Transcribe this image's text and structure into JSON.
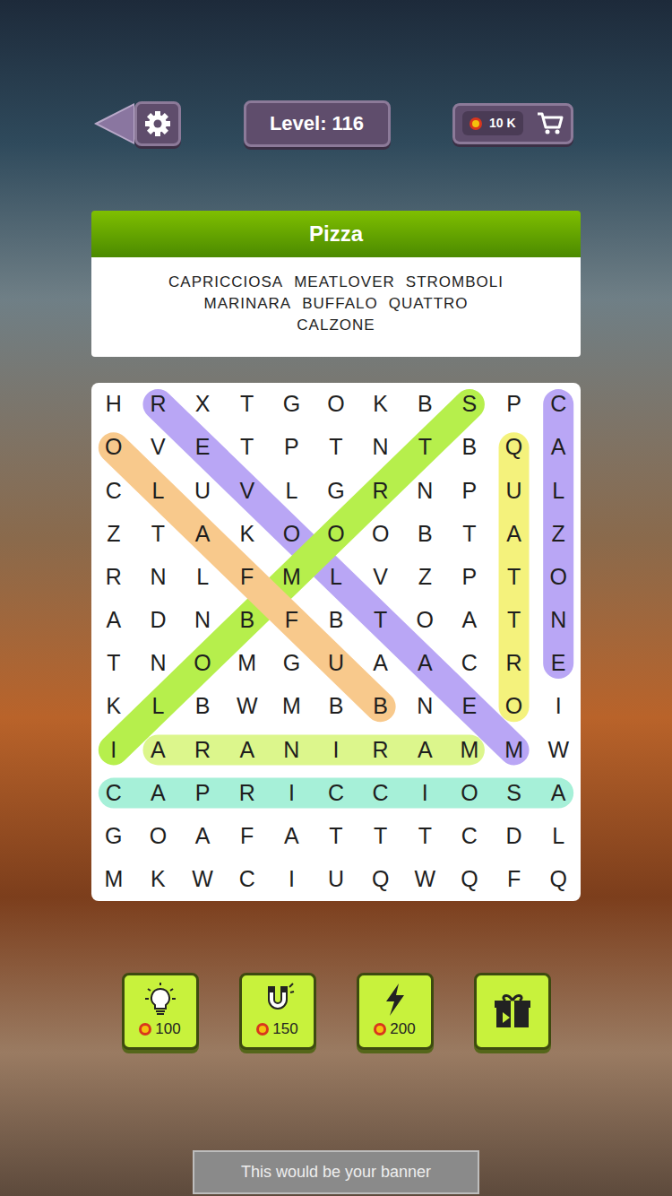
{
  "topbar": {
    "level": "Level: 116",
    "coins": "10 K"
  },
  "puzzle": {
    "title": "Pizza",
    "word_lines": [
      [
        "CAPRICCIOSA",
        "MEATLOVER",
        "STROMBOLI"
      ],
      [
        "MARINARA",
        "BUFFALO",
        "QUATTRO"
      ],
      [
        "CALZONE"
      ]
    ]
  },
  "grid": {
    "rows": [
      [
        "H",
        "R",
        "X",
        "T",
        "G",
        "O",
        "K",
        "B",
        "S",
        "P",
        "C"
      ],
      [
        "O",
        "V",
        "E",
        "T",
        "P",
        "T",
        "N",
        "T",
        "B",
        "Q",
        "A"
      ],
      [
        "C",
        "L",
        "U",
        "V",
        "L",
        "G",
        "R",
        "N",
        "P",
        "U",
        "L"
      ],
      [
        "Z",
        "T",
        "A",
        "K",
        "O",
        "O",
        "O",
        "B",
        "T",
        "A",
        "Z"
      ],
      [
        "R",
        "N",
        "L",
        "F",
        "M",
        "L",
        "V",
        "Z",
        "P",
        "T",
        "O"
      ],
      [
        "A",
        "D",
        "N",
        "B",
        "F",
        "B",
        "T",
        "O",
        "A",
        "T",
        "N"
      ],
      [
        "T",
        "N",
        "O",
        "M",
        "G",
        "U",
        "A",
        "A",
        "C",
        "R",
        "E"
      ],
      [
        "K",
        "L",
        "B",
        "W",
        "M",
        "B",
        "B",
        "N",
        "E",
        "O",
        "I"
      ],
      [
        "I",
        "A",
        "R",
        "A",
        "N",
        "I",
        "R",
        "A",
        "M",
        "M",
        "W"
      ],
      [
        "C",
        "A",
        "P",
        "R",
        "I",
        "C",
        "C",
        "I",
        "O",
        "S",
        "A"
      ],
      [
        "G",
        "O",
        "A",
        "F",
        "A",
        "T",
        "T",
        "T",
        "C",
        "D",
        "L"
      ],
      [
        "M",
        "K",
        "W",
        "C",
        "I",
        "U",
        "Q",
        "W",
        "Q",
        "F",
        "Q"
      ]
    ],
    "found": [
      {
        "from": [
          0,
          10
        ],
        "to": [
          6,
          10
        ],
        "color": "#b9a6f5"
      },
      {
        "from": [
          1,
          9
        ],
        "to": [
          7,
          9
        ],
        "color": "#f4f27c"
      },
      {
        "from": [
          9,
          0
        ],
        "to": [
          9,
          10
        ],
        "color": "#a6f0d8"
      },
      {
        "from": [
          8,
          8
        ],
        "to": [
          8,
          1
        ],
        "color": "#dcf68c"
      },
      {
        "from": [
          8,
          9
        ],
        "to": [
          0,
          1
        ],
        "color": "#b9a6f5"
      },
      {
        "from": [
          0,
          8
        ],
        "to": [
          8,
          0
        ],
        "color": "#b6ef4c"
      },
      {
        "from": [
          7,
          6
        ],
        "to": [
          1,
          0
        ],
        "color": "#f8c98c"
      }
    ]
  },
  "boosters": [
    {
      "kind": "hint",
      "cost": "100"
    },
    {
      "kind": "magnet",
      "cost": "150"
    },
    {
      "kind": "lightning",
      "cost": "200"
    },
    {
      "kind": "video",
      "cost": ""
    }
  ],
  "banner": "This would be your banner"
}
